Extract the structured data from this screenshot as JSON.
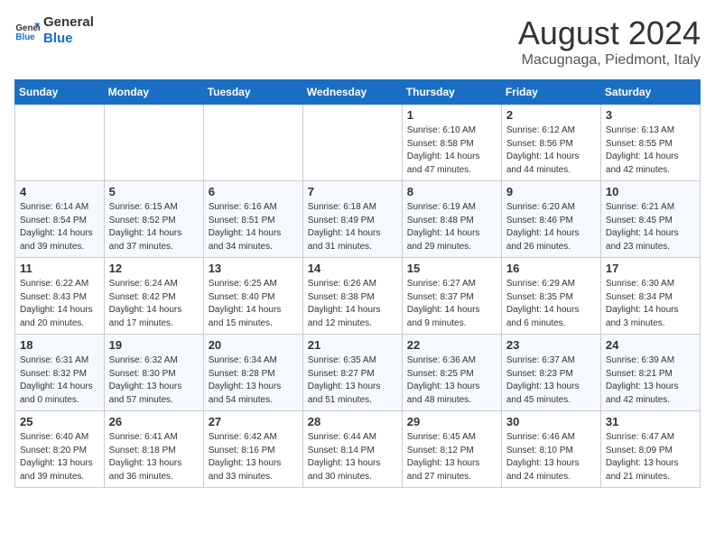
{
  "header": {
    "logo_line1": "General",
    "logo_line2": "Blue",
    "month": "August 2024",
    "location": "Macugnaga, Piedmont, Italy"
  },
  "weekdays": [
    "Sunday",
    "Monday",
    "Tuesday",
    "Wednesday",
    "Thursday",
    "Friday",
    "Saturday"
  ],
  "weeks": [
    [
      {
        "day": "",
        "info": ""
      },
      {
        "day": "",
        "info": ""
      },
      {
        "day": "",
        "info": ""
      },
      {
        "day": "",
        "info": ""
      },
      {
        "day": "1",
        "info": "Sunrise: 6:10 AM\nSunset: 8:58 PM\nDaylight: 14 hours and 47 minutes."
      },
      {
        "day": "2",
        "info": "Sunrise: 6:12 AM\nSunset: 8:56 PM\nDaylight: 14 hours and 44 minutes."
      },
      {
        "day": "3",
        "info": "Sunrise: 6:13 AM\nSunset: 8:55 PM\nDaylight: 14 hours and 42 minutes."
      }
    ],
    [
      {
        "day": "4",
        "info": "Sunrise: 6:14 AM\nSunset: 8:54 PM\nDaylight: 14 hours and 39 minutes."
      },
      {
        "day": "5",
        "info": "Sunrise: 6:15 AM\nSunset: 8:52 PM\nDaylight: 14 hours and 37 minutes."
      },
      {
        "day": "6",
        "info": "Sunrise: 6:16 AM\nSunset: 8:51 PM\nDaylight: 14 hours and 34 minutes."
      },
      {
        "day": "7",
        "info": "Sunrise: 6:18 AM\nSunset: 8:49 PM\nDaylight: 14 hours and 31 minutes."
      },
      {
        "day": "8",
        "info": "Sunrise: 6:19 AM\nSunset: 8:48 PM\nDaylight: 14 hours and 29 minutes."
      },
      {
        "day": "9",
        "info": "Sunrise: 6:20 AM\nSunset: 8:46 PM\nDaylight: 14 hours and 26 minutes."
      },
      {
        "day": "10",
        "info": "Sunrise: 6:21 AM\nSunset: 8:45 PM\nDaylight: 14 hours and 23 minutes."
      }
    ],
    [
      {
        "day": "11",
        "info": "Sunrise: 6:22 AM\nSunset: 8:43 PM\nDaylight: 14 hours and 20 minutes."
      },
      {
        "day": "12",
        "info": "Sunrise: 6:24 AM\nSunset: 8:42 PM\nDaylight: 14 hours and 17 minutes."
      },
      {
        "day": "13",
        "info": "Sunrise: 6:25 AM\nSunset: 8:40 PM\nDaylight: 14 hours and 15 minutes."
      },
      {
        "day": "14",
        "info": "Sunrise: 6:26 AM\nSunset: 8:38 PM\nDaylight: 14 hours and 12 minutes."
      },
      {
        "day": "15",
        "info": "Sunrise: 6:27 AM\nSunset: 8:37 PM\nDaylight: 14 hours and 9 minutes."
      },
      {
        "day": "16",
        "info": "Sunrise: 6:29 AM\nSunset: 8:35 PM\nDaylight: 14 hours and 6 minutes."
      },
      {
        "day": "17",
        "info": "Sunrise: 6:30 AM\nSunset: 8:34 PM\nDaylight: 14 hours and 3 minutes."
      }
    ],
    [
      {
        "day": "18",
        "info": "Sunrise: 6:31 AM\nSunset: 8:32 PM\nDaylight: 14 hours and 0 minutes."
      },
      {
        "day": "19",
        "info": "Sunrise: 6:32 AM\nSunset: 8:30 PM\nDaylight: 13 hours and 57 minutes."
      },
      {
        "day": "20",
        "info": "Sunrise: 6:34 AM\nSunset: 8:28 PM\nDaylight: 13 hours and 54 minutes."
      },
      {
        "day": "21",
        "info": "Sunrise: 6:35 AM\nSunset: 8:27 PM\nDaylight: 13 hours and 51 minutes."
      },
      {
        "day": "22",
        "info": "Sunrise: 6:36 AM\nSunset: 8:25 PM\nDaylight: 13 hours and 48 minutes."
      },
      {
        "day": "23",
        "info": "Sunrise: 6:37 AM\nSunset: 8:23 PM\nDaylight: 13 hours and 45 minutes."
      },
      {
        "day": "24",
        "info": "Sunrise: 6:39 AM\nSunset: 8:21 PM\nDaylight: 13 hours and 42 minutes."
      }
    ],
    [
      {
        "day": "25",
        "info": "Sunrise: 6:40 AM\nSunset: 8:20 PM\nDaylight: 13 hours and 39 minutes."
      },
      {
        "day": "26",
        "info": "Sunrise: 6:41 AM\nSunset: 8:18 PM\nDaylight: 13 hours and 36 minutes."
      },
      {
        "day": "27",
        "info": "Sunrise: 6:42 AM\nSunset: 8:16 PM\nDaylight: 13 hours and 33 minutes."
      },
      {
        "day": "28",
        "info": "Sunrise: 6:44 AM\nSunset: 8:14 PM\nDaylight: 13 hours and 30 minutes."
      },
      {
        "day": "29",
        "info": "Sunrise: 6:45 AM\nSunset: 8:12 PM\nDaylight: 13 hours and 27 minutes."
      },
      {
        "day": "30",
        "info": "Sunrise: 6:46 AM\nSunset: 8:10 PM\nDaylight: 13 hours and 24 minutes."
      },
      {
        "day": "31",
        "info": "Sunrise: 6:47 AM\nSunset: 8:09 PM\nDaylight: 13 hours and 21 minutes."
      }
    ]
  ]
}
